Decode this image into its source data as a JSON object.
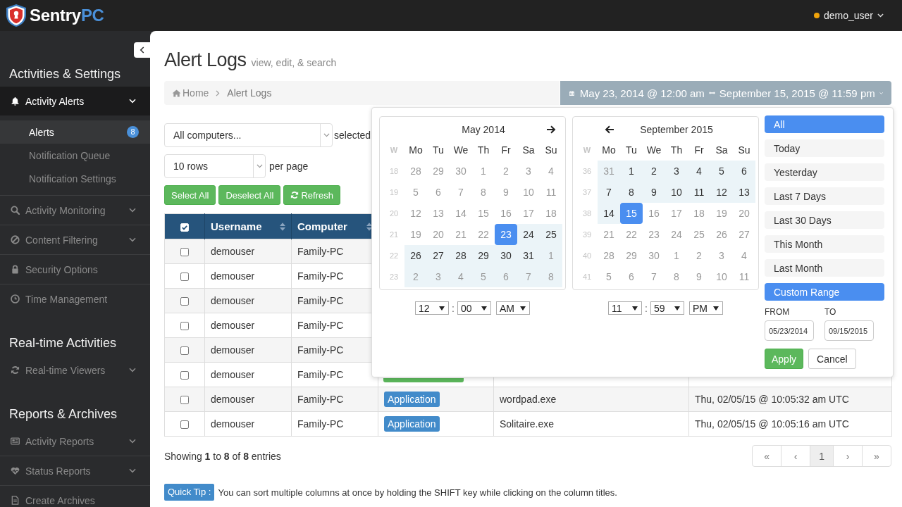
{
  "topbar": {
    "logo": {
      "text": "Sentry",
      "accent": "PC"
    },
    "user": {
      "name": "demo_user"
    }
  },
  "sidebar": {
    "sections": [
      {
        "title": "Activities & Settings",
        "items": [
          {
            "label": "Activity Alerts",
            "selected": true,
            "expandable": true,
            "expanded": true,
            "children": [
              {
                "label": "Alerts",
                "selected": true,
                "badge": "8"
              },
              {
                "label": "Notification Queue",
                "selected": false
              },
              {
                "label": "Notification Settings",
                "selected": false
              }
            ]
          },
          {
            "label": "Activity Monitoring",
            "selected": false,
            "expandable": true,
            "expanded": false
          },
          {
            "label": "Content Filtering",
            "selected": false,
            "expandable": true,
            "expanded": false
          },
          {
            "label": "Security Options",
            "selected": false,
            "expandable": false,
            "expanded": false
          },
          {
            "label": "Time Management",
            "selected": false,
            "expandable": false,
            "expanded": false
          }
        ]
      },
      {
        "title": "Real-time Activities",
        "items": [
          {
            "label": "Real-time Viewers",
            "selected": false,
            "expandable": true,
            "expanded": false
          }
        ]
      },
      {
        "title": "Reports & Archives",
        "items": [
          {
            "label": "Activity Reports",
            "selected": false,
            "expandable": true,
            "expanded": false
          },
          {
            "label": "Status Reports",
            "selected": false,
            "expandable": true,
            "expanded": false
          },
          {
            "label": "Create Archives",
            "selected": false,
            "expandable": false,
            "expanded": false
          }
        ]
      }
    ]
  },
  "page": {
    "title": "Alert Logs",
    "subtitle": "view, edit, & search"
  },
  "breadcrumb": [
    {
      "label": "Home",
      "kind": "home"
    },
    {
      "label": "Alert Logs",
      "kind": "current"
    }
  ],
  "date_range": {
    "start": "May 23, 2014 @ 12:00 am",
    "end": "September 15, 2015 @ 11:59 pm"
  },
  "filters": {
    "computer": {
      "value": "All computers...",
      "suffix": "selected"
    },
    "rows": {
      "value": "10 rows",
      "suffix": "per page"
    }
  },
  "actions": [
    {
      "label": "Select All",
      "kind": "plain"
    },
    {
      "label": "Deselect All",
      "kind": "plain"
    },
    {
      "label": "Refresh",
      "kind": "refresh"
    }
  ],
  "table": {
    "select_all": {
      "checked": true
    },
    "columns": [
      {
        "label": "Username",
        "sortable": true
      },
      {
        "label": "Computer",
        "sortable": true
      }
    ],
    "rows": [
      {
        "checked": false,
        "username": "demouser",
        "computer": "Family-PC"
      },
      {
        "checked": false,
        "username": "demouser",
        "computer": "Family-PC"
      },
      {
        "checked": false,
        "username": "demouser",
        "computer": "Family-PC"
      },
      {
        "checked": false,
        "username": "demouser",
        "computer": "Family-PC"
      },
      {
        "checked": false,
        "username": "demouser",
        "computer": "Family-PC"
      },
      {
        "checked": false,
        "username": "demouser",
        "computer": "Family-PC",
        "type": {
          "color": "#5cb85c"
        }
      },
      {
        "checked": false,
        "username": "demouser",
        "computer": "Family-PC",
        "type": {
          "label": "Application",
          "color": "#428bca"
        },
        "item": "wordpad.exe",
        "time": "Thu, 02/05/15 @ 10:05:32 am UTC"
      },
      {
        "checked": false,
        "username": "demouser",
        "computer": "Family-PC",
        "type": {
          "label": "Application",
          "color": "#428bca"
        },
        "item": "Solitaire.exe",
        "time": "Thu, 02/05/15 @ 10:05:16 am UTC"
      }
    ]
  },
  "footer": {
    "info": "Showing **1** to **8** of **8** entries",
    "pages": [
      {
        "label": "«",
        "selected": false
      },
      {
        "label": "‹",
        "selected": false
      },
      {
        "label": "1",
        "selected": true
      },
      {
        "label": "›",
        "selected": false
      },
      {
        "label": "»",
        "selected": false
      }
    ]
  },
  "tip": {
    "label": "Quick Tip :",
    "text": "You can sort multiple columns at once by holding the SHIFT key while clicking on the column titles."
  },
  "date_picker": {
    "calendars": [
      {
        "title": "May 2014",
        "kind": "next",
        "week_label": "W",
        "weekdays": [
          "Mo",
          "Tu",
          "We",
          "Th",
          "Fr",
          "Sa",
          "Su"
        ],
        "weeks": [
          {
            "number": "18",
            "days": [
              {
                "day": "28",
                "muted": true,
                "in_range": false,
                "selected": false
              },
              {
                "day": "29",
                "muted": true,
                "in_range": false,
                "selected": false
              },
              {
                "day": "30",
                "muted": true,
                "in_range": false,
                "selected": false
              },
              {
                "day": "1",
                "muted": true,
                "in_range": false,
                "selected": false
              },
              {
                "day": "2",
                "muted": true,
                "in_range": false,
                "selected": false
              },
              {
                "day": "3",
                "muted": true,
                "in_range": false,
                "selected": false
              },
              {
                "day": "4",
                "muted": true,
                "in_range": false,
                "selected": false
              }
            ]
          },
          {
            "number": "19",
            "days": [
              {
                "day": "5",
                "muted": true,
                "in_range": false,
                "selected": false
              },
              {
                "day": "6",
                "muted": true,
                "in_range": false,
                "selected": false
              },
              {
                "day": "7",
                "muted": true,
                "in_range": false,
                "selected": false
              },
              {
                "day": "8",
                "muted": true,
                "in_range": false,
                "selected": false
              },
              {
                "day": "9",
                "muted": true,
                "in_range": false,
                "selected": false
              },
              {
                "day": "10",
                "muted": true,
                "in_range": false,
                "selected": false
              },
              {
                "day": "11",
                "muted": true,
                "in_range": false,
                "selected": false
              }
            ]
          },
          {
            "number": "20",
            "days": [
              {
                "day": "12",
                "muted": true,
                "in_range": false,
                "selected": false
              },
              {
                "day": "13",
                "muted": true,
                "in_range": false,
                "selected": false
              },
              {
                "day": "14",
                "muted": true,
                "in_range": false,
                "selected": false
              },
              {
                "day": "15",
                "muted": true,
                "in_range": false,
                "selected": false
              },
              {
                "day": "16",
                "muted": true,
                "in_range": false,
                "selected": false
              },
              {
                "day": "17",
                "muted": true,
                "in_range": false,
                "selected": false
              },
              {
                "day": "18",
                "muted": true,
                "in_range": false,
                "selected": false
              }
            ]
          },
          {
            "number": "21",
            "days": [
              {
                "day": "19",
                "muted": true,
                "in_range": false,
                "selected": false
              },
              {
                "day": "20",
                "muted": true,
                "in_range": false,
                "selected": false
              },
              {
                "day": "21",
                "muted": true,
                "in_range": false,
                "selected": false
              },
              {
                "day": "22",
                "muted": true,
                "in_range": false,
                "selected": false
              },
              {
                "day": "23",
                "muted": false,
                "in_range": true,
                "selected": true
              },
              {
                "day": "24",
                "muted": false,
                "in_range": true,
                "selected": false
              },
              {
                "day": "25",
                "muted": false,
                "in_range": true,
                "selected": false
              }
            ]
          },
          {
            "number": "22",
            "days": [
              {
                "day": "26",
                "muted": false,
                "in_range": true,
                "selected": false
              },
              {
                "day": "27",
                "muted": false,
                "in_range": true,
                "selected": false
              },
              {
                "day": "28",
                "muted": false,
                "in_range": true,
                "selected": false
              },
              {
                "day": "29",
                "muted": false,
                "in_range": true,
                "selected": false
              },
              {
                "day": "30",
                "muted": false,
                "in_range": true,
                "selected": false
              },
              {
                "day": "31",
                "muted": false,
                "in_range": true,
                "selected": false
              },
              {
                "day": "1",
                "muted": true,
                "in_range": true,
                "selected": false
              }
            ]
          },
          {
            "number": "23",
            "days": [
              {
                "day": "2",
                "muted": true,
                "in_range": true,
                "selected": false
              },
              {
                "day": "3",
                "muted": true,
                "in_range": true,
                "selected": false
              },
              {
                "day": "4",
                "muted": true,
                "in_range": true,
                "selected": false
              },
              {
                "day": "5",
                "muted": true,
                "in_range": true,
                "selected": false
              },
              {
                "day": "6",
                "muted": true,
                "in_range": true,
                "selected": false
              },
              {
                "day": "7",
                "muted": true,
                "in_range": true,
                "selected": false
              },
              {
                "day": "8",
                "muted": true,
                "in_range": true,
                "selected": false
              }
            ]
          }
        ],
        "time": {
          "hour": "12",
          "separator": ":",
          "minute": "00",
          "period": "AM"
        }
      },
      {
        "title": "September 2015",
        "kind": "prev",
        "week_label": "W",
        "weekdays": [
          "Mo",
          "Tu",
          "We",
          "Th",
          "Fr",
          "Sa",
          "Su"
        ],
        "weeks": [
          {
            "number": "36",
            "days": [
              {
                "day": "31",
                "muted": true,
                "in_range": true,
                "selected": false
              },
              {
                "day": "1",
                "muted": false,
                "in_range": true,
                "selected": false
              },
              {
                "day": "2",
                "muted": false,
                "in_range": true,
                "selected": false
              },
              {
                "day": "3",
                "muted": false,
                "in_range": true,
                "selected": false
              },
              {
                "day": "4",
                "muted": false,
                "in_range": true,
                "selected": false
              },
              {
                "day": "5",
                "muted": false,
                "in_range": true,
                "selected": false
              },
              {
                "day": "6",
                "muted": false,
                "in_range": true,
                "selected": false
              }
            ]
          },
          {
            "number": "37",
            "days": [
              {
                "day": "7",
                "muted": false,
                "in_range": true,
                "selected": false
              },
              {
                "day": "8",
                "muted": false,
                "in_range": true,
                "selected": false
              },
              {
                "day": "9",
                "muted": false,
                "in_range": true,
                "selected": false
              },
              {
                "day": "10",
                "muted": false,
                "in_range": true,
                "selected": false
              },
              {
                "day": "11",
                "muted": false,
                "in_range": true,
                "selected": false
              },
              {
                "day": "12",
                "muted": false,
                "in_range": true,
                "selected": false
              },
              {
                "day": "13",
                "muted": false,
                "in_range": true,
                "selected": false
              }
            ]
          },
          {
            "number": "38",
            "days": [
              {
                "day": "14",
                "muted": false,
                "in_range": true,
                "selected": false
              },
              {
                "day": "15",
                "muted": false,
                "in_range": true,
                "selected": true
              },
              {
                "day": "16",
                "muted": true,
                "in_range": false,
                "selected": false
              },
              {
                "day": "17",
                "muted": true,
                "in_range": false,
                "selected": false
              },
              {
                "day": "18",
                "muted": true,
                "in_range": false,
                "selected": false
              },
              {
                "day": "19",
                "muted": true,
                "in_range": false,
                "selected": false
              },
              {
                "day": "20",
                "muted": true,
                "in_range": false,
                "selected": false
              }
            ]
          },
          {
            "number": "39",
            "days": [
              {
                "day": "21",
                "muted": true,
                "in_range": false,
                "selected": false
              },
              {
                "day": "22",
                "muted": true,
                "in_range": false,
                "selected": false
              },
              {
                "day": "23",
                "muted": true,
                "in_range": false,
                "selected": false
              },
              {
                "day": "24",
                "muted": true,
                "in_range": false,
                "selected": false
              },
              {
                "day": "25",
                "muted": true,
                "in_range": false,
                "selected": false
              },
              {
                "day": "26",
                "muted": true,
                "in_range": false,
                "selected": false
              },
              {
                "day": "27",
                "muted": true,
                "in_range": false,
                "selected": false
              }
            ]
          },
          {
            "number": "40",
            "days": [
              {
                "day": "28",
                "muted": true,
                "in_range": false,
                "selected": false
              },
              {
                "day": "29",
                "muted": true,
                "in_range": false,
                "selected": false
              },
              {
                "day": "30",
                "muted": true,
                "in_range": false,
                "selected": false
              },
              {
                "day": "1",
                "muted": true,
                "in_range": false,
                "selected": false
              },
              {
                "day": "2",
                "muted": true,
                "in_range": false,
                "selected": false
              },
              {
                "day": "3",
                "muted": true,
                "in_range": false,
                "selected": false
              },
              {
                "day": "4",
                "muted": true,
                "in_range": false,
                "selected": false
              }
            ]
          },
          {
            "number": "41",
            "days": [
              {
                "day": "5",
                "muted": true,
                "in_range": false,
                "selected": false
              },
              {
                "day": "6",
                "muted": true,
                "in_range": false,
                "selected": false
              },
              {
                "day": "7",
                "muted": true,
                "in_range": false,
                "selected": false
              },
              {
                "day": "8",
                "muted": true,
                "in_range": false,
                "selected": false
              },
              {
                "day": "9",
                "muted": true,
                "in_range": false,
                "selected": false
              },
              {
                "day": "10",
                "muted": true,
                "in_range": false,
                "selected": false
              },
              {
                "day": "11",
                "muted": true,
                "in_range": false,
                "selected": false
              }
            ]
          }
        ],
        "time": {
          "hour": "11",
          "separator": ":",
          "minute": "59",
          "period": "PM"
        }
      }
    ],
    "ranges": [
      {
        "label": "All",
        "selected": true
      },
      {
        "label": "Today",
        "selected": false
      },
      {
        "label": "Yesterday",
        "selected": false
      },
      {
        "label": "Last 7 Days",
        "selected": false
      },
      {
        "label": "Last 30 Days",
        "selected": false
      },
      {
        "label": "This Month",
        "selected": false
      },
      {
        "label": "Last Month",
        "selected": false
      },
      {
        "label": "Custom Range",
        "selected": true
      }
    ],
    "from_label": "FROM",
    "from": "05/23/2014",
    "to_label": "TO",
    "to": "09/15/2015",
    "apply": "Apply",
    "cancel": "Cancel"
  }
}
